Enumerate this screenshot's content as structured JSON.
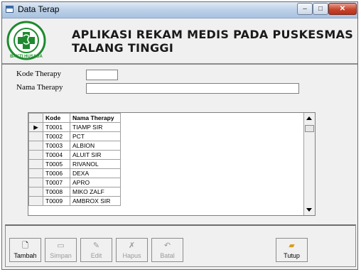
{
  "window": {
    "title": "Data Terap",
    "controls": {
      "minimize": "–",
      "maximize": "□",
      "close": "✕"
    }
  },
  "header": {
    "app_title_line1": "APLIKASI REKAM MEDIS PADA PUSKESMAS",
    "app_title_line2": "TALANG TINGGI",
    "logo_text": "BAKTI HUSADA",
    "logo_color": "#1e8a2e"
  },
  "form": {
    "kode_label": "Kode Therapy",
    "kode_value": "",
    "nama_label": "Nama Therapy",
    "nama_value": ""
  },
  "grid": {
    "columns": [
      "Kode",
      "Nama Therapy"
    ],
    "current_row_marker": "▶",
    "rows": [
      [
        "T0001",
        "TIAMP SIR"
      ],
      [
        "T0002",
        "PCT"
      ],
      [
        "T0003",
        "ALBION"
      ],
      [
        "T0004",
        "ALUIT SIR"
      ],
      [
        "T0005",
        "RIVANOL"
      ],
      [
        "T0006",
        "DEXA"
      ],
      [
        "T0007",
        "APRO"
      ],
      [
        "T0008",
        "MIKO ZALF"
      ],
      [
        "T0009",
        "AMBROX SIR"
      ]
    ]
  },
  "toolbar": {
    "tambah": {
      "label": "Tambah",
      "icon": "new-document-icon"
    },
    "simpan": {
      "label": "Simpan",
      "icon": "floppy-disk-icon"
    },
    "edit": {
      "label": "Edit",
      "icon": "edit-icon"
    },
    "hapus": {
      "label": "Hapus",
      "icon": "delete-icon"
    },
    "batal": {
      "label": "Batal",
      "icon": "undo-icon"
    },
    "tutup": {
      "label": "Tutup",
      "icon": "folder-close-icon"
    }
  }
}
